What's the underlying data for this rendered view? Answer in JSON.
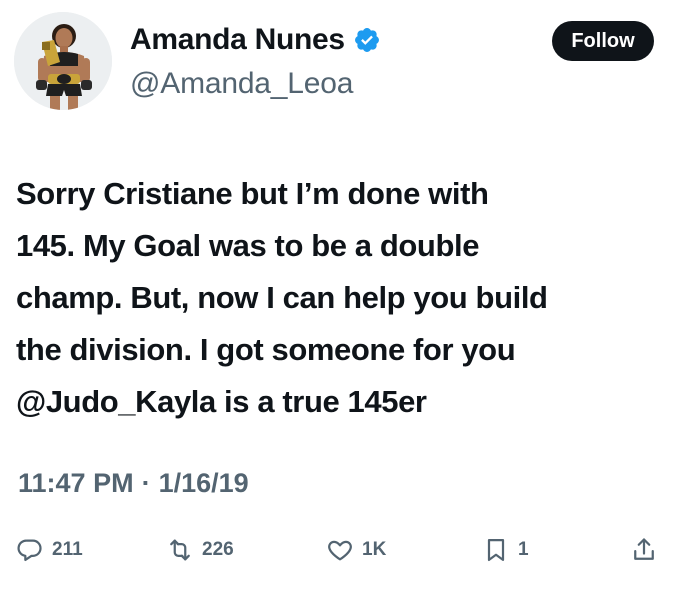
{
  "author": {
    "display_name": "Amanda Nunes",
    "handle": "@Amanda_Leoa",
    "verified": true,
    "avatar_icon": "profile-photo"
  },
  "follow_button": {
    "label": "Follow"
  },
  "tweet": {
    "lines": [
      "Sorry Cristiane but I’m done with",
      "145. My Goal was to be a double",
      "champ. But, now I can help you build",
      "the division. I got someone for you",
      "@Judo_Kayla is a true 145er"
    ]
  },
  "timestamp": {
    "time": "11:47 PM",
    "separator": "·",
    "date": "1/16/19"
  },
  "actions": {
    "reply": {
      "icon": "reply-icon",
      "count": "211"
    },
    "repost": {
      "icon": "repost-icon",
      "count": "226"
    },
    "like": {
      "icon": "heart-icon",
      "count": "1K"
    },
    "bookmark": {
      "icon": "bookmark-icon",
      "count": "1"
    },
    "share": {
      "icon": "share-icon"
    }
  },
  "colors": {
    "text": "#0f1419",
    "secondary_text": "#536471",
    "verified_badge": "#1d9bf0",
    "follow_button_bg": "#0f1419"
  }
}
